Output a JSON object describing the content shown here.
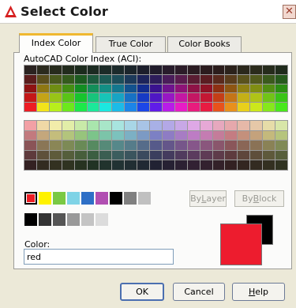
{
  "window": {
    "title": "Select Color",
    "close_glyph": "✕"
  },
  "tabs": [
    {
      "label": "Index Color",
      "active": true
    },
    {
      "label": "True Color",
      "active": false
    },
    {
      "label": "Color Books",
      "active": false
    }
  ],
  "aci": {
    "label": "AutoCAD Color Index (ACI):",
    "top_grid_rows": [
      [
        "#2a2321",
        "#2b2a1e",
        "#272b1d",
        "#222b1d",
        "#1c2b1d",
        "#1c2b22",
        "#1c2b28",
        "#1c2a2b",
        "#1c252b",
        "#1c1e2b",
        "#211c2b",
        "#281c2b",
        "#2b1c28",
        "#2b1c22",
        "#2b1c1e",
        "#2b1d1c",
        "#2b221c",
        "#2b281c",
        "#2b2b1c",
        "#262b1c",
        "#202b1c"
      ],
      [
        "#5a1d1d",
        "#5a4e1d",
        "#4a5a1d",
        "#355a1d",
        "#1d5a21",
        "#1d5a3e",
        "#1d5a55",
        "#1d4e5a",
        "#1d3a5a",
        "#1d245a",
        "#2e1d5a",
        "#4a1d5a",
        "#5a1d4e",
        "#5a1d33",
        "#5a1d22",
        "#5a2a1d",
        "#5a3d1d",
        "#5a521d",
        "#525a1d",
        "#3b5a1d",
        "#275a1d"
      ],
      [
        "#8e1313",
        "#8e7713",
        "#6f8e13",
        "#448e13",
        "#138e23",
        "#138e5a",
        "#138e85",
        "#13778e",
        "#13528e",
        "#132c8e",
        "#3a138e",
        "#6f138e",
        "#8e1377",
        "#8e1347",
        "#8e1326",
        "#8e3013",
        "#8e5613",
        "#8e8013",
        "#808e13",
        "#528e13",
        "#2c8e13"
      ],
      [
        "#c41717",
        "#c4a417",
        "#98c417",
        "#5ac417",
        "#17c42e",
        "#17c47b",
        "#17c4b8",
        "#17a4c4",
        "#1771c4",
        "#173ac4",
        "#4f17c4",
        "#9817c4",
        "#c417a4",
        "#c41763",
        "#c41733",
        "#c43e17",
        "#c47517",
        "#c4b017",
        "#b0c417",
        "#71c417",
        "#3ac417"
      ],
      [
        "#ed1c24",
        "#f2e31b",
        "#b8ee1c",
        "#6ce81c",
        "#1ce84a",
        "#1ce89a",
        "#1ce8e0",
        "#1cbbe8",
        "#1c85e8",
        "#1c46e8",
        "#601ce8",
        "#b81ce8",
        "#e81cc6",
        "#e81c7d",
        "#e81c42",
        "#e8521c",
        "#e8901c",
        "#e8d01c",
        "#cce81c",
        "#86e81c",
        "#48e81c"
      ]
    ],
    "bottom_grid_rows": [
      [
        "#f2a0a5",
        "#f0d8a6",
        "#f2ecaa",
        "#e2eea8",
        "#c8eaa8",
        "#a9e6ad",
        "#a8e6c8",
        "#a8e4df",
        "#a8d6e6",
        "#a8c4e6",
        "#a8b0e6",
        "#b3a8e6",
        "#c8a8e6",
        "#dea8e6",
        "#e6a8d6",
        "#e6a8be",
        "#e6a8ac",
        "#e6b8a8",
        "#e6c8a8",
        "#e6dca8",
        "#d8e6a8"
      ],
      [
        "#c27a7e",
        "#c4a77c",
        "#c4bd7c",
        "#b3c47c",
        "#97c47c",
        "#7cc48a",
        "#7cc4a9",
        "#7cc2bd",
        "#7cb0c4",
        "#7c9ac4",
        "#7c80c4",
        "#8e7cc4",
        "#a77cc4",
        "#bd7cc4",
        "#c47cb2",
        "#c47c9a",
        "#c47c82",
        "#c4907c",
        "#c4a27c",
        "#c4b97c",
        "#b6c47c"
      ],
      [
        "#8a5457",
        "#8a7656",
        "#8a8656",
        "#7d8a56",
        "#698a56",
        "#568a60",
        "#568a78",
        "#56888a",
        "#567c8a",
        "#566c8a",
        "#565a8a",
        "#64568a",
        "#76568a",
        "#86568a",
        "#8a567d",
        "#8a566c",
        "#8a565a",
        "#8a6656",
        "#8a7256",
        "#8a8256",
        "#808a56"
      ],
      [
        "#5e3a3c",
        "#5e503b",
        "#5e5b3b",
        "#555e3b",
        "#475e3b",
        "#3b5e41",
        "#3b5e52",
        "#3b5d5e",
        "#3b555e",
        "#3b4a5e",
        "#3b3e5e",
        "#443b5e",
        "#503b5e",
        "#5b3b5e",
        "#5e3b55",
        "#5e3b4a",
        "#5e3b3e",
        "#5e463b",
        "#5e4e3b",
        "#5e593b",
        "#575e3b"
      ],
      [
        "#332122",
        "#332c21",
        "#333121",
        "#2f3321",
        "#273321",
        "#213324",
        "#21332d",
        "#213233",
        "#212e33",
        "#212933",
        "#212233",
        "#262133",
        "#2c2133",
        "#322133",
        "#33212f",
        "#332129",
        "#332122",
        "#332621",
        "#332b21",
        "#333021",
        "#303321"
      ]
    ]
  },
  "standard_colors": [
    {
      "name": "red",
      "hex": "#ed1c24",
      "selected": true
    },
    {
      "name": "yellow",
      "hex": "#fff200"
    },
    {
      "name": "green",
      "hex": "#7ac943"
    },
    {
      "name": "cyan",
      "hex": "#7fd3e6"
    },
    {
      "name": "blue",
      "hex": "#2e6fc6"
    },
    {
      "name": "magenta",
      "hex": "#b14fb2"
    },
    {
      "name": "black",
      "hex": "#000000"
    },
    {
      "name": "gray-8",
      "hex": "#808080"
    },
    {
      "name": "gray-9",
      "hex": "#c0c0c0"
    }
  ],
  "gray_shades": [
    "#000000",
    "#333333",
    "#555555",
    "#999999",
    "#c4c4c4",
    "#dcdcdc"
  ],
  "buttons": {
    "bylayer": {
      "label": "ByLayer",
      "underline_index": 2
    },
    "byblock": {
      "label": "ByBlock",
      "underline_index": 2
    },
    "ok": "OK",
    "cancel": "Cancel",
    "help": {
      "pre": "",
      "u": "H",
      "post": "elp"
    }
  },
  "color_field": {
    "label": "Color:",
    "value": "red"
  },
  "preview": {
    "new_color": "#ed1c2e",
    "old_color": "#000000"
  }
}
